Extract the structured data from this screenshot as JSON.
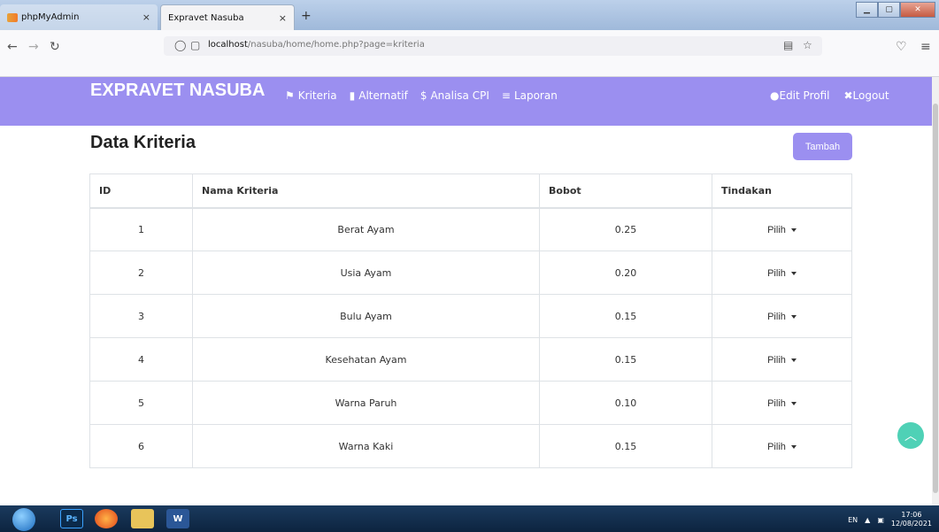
{
  "browser": {
    "tabs": [
      {
        "title": "phpMyAdmin",
        "close": "×"
      },
      {
        "title": "Expravet Nasuba",
        "close": "×"
      }
    ],
    "new_tab": "+",
    "url_host": "localhost",
    "url_path": "/nasuba/home/home.php?page=kriteria"
  },
  "header": {
    "brand": "EXPRAVET NASUBA",
    "menu": [
      {
        "icon": "flag-icon",
        "glyph": "⚑",
        "label": "Kriteria"
      },
      {
        "icon": "file-icon",
        "glyph": "▮",
        "label": "Alternatif"
      },
      {
        "icon": "dollar-icon",
        "glyph": "$",
        "label": "Analisa CPI"
      },
      {
        "icon": "list-icon",
        "glyph": "≡",
        "label": "Laporan"
      }
    ],
    "right": [
      {
        "icon": "user-icon",
        "glyph": "●",
        "label": "Edit Profil"
      },
      {
        "icon": "close-icon",
        "glyph": "✖",
        "label": "Logout"
      }
    ]
  },
  "page": {
    "title": "Data Kriteria",
    "add_button": "Tambah"
  },
  "table": {
    "headers": [
      "ID",
      "Nama Kriteria",
      "Bobot",
      "Tindakan"
    ],
    "rows": [
      {
        "id": "1",
        "name": "Berat Ayam",
        "bobot": "0.25",
        "action": "Pilih"
      },
      {
        "id": "2",
        "name": "Usia Ayam",
        "bobot": "0.20",
        "action": "Pilih"
      },
      {
        "id": "3",
        "name": "Bulu Ayam",
        "bobot": "0.15",
        "action": "Pilih"
      },
      {
        "id": "4",
        "name": "Kesehatan Ayam",
        "bobot": "0.15",
        "action": "Pilih"
      },
      {
        "id": "5",
        "name": "Warna Paruh",
        "bobot": "0.10",
        "action": "Pilih"
      },
      {
        "id": "6",
        "name": "Warna Kaki",
        "bobot": "0.15",
        "action": "Pilih"
      }
    ]
  },
  "taskbar": {
    "lang": "EN",
    "time": "17:06",
    "date": "12/08/2021"
  },
  "colors": {
    "accent": "#9b8ff0",
    "totop": "#4fd1b6"
  }
}
